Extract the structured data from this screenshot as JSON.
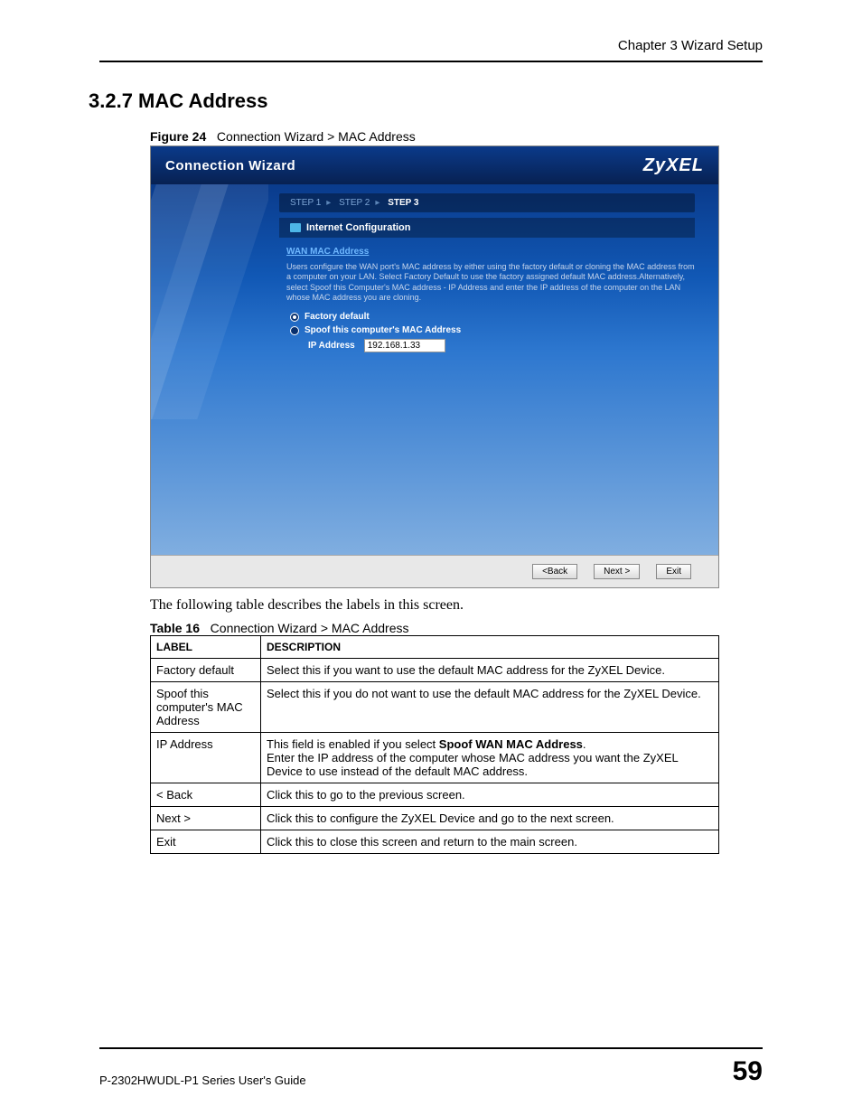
{
  "header": {
    "chapter": "Chapter 3 Wizard Setup"
  },
  "section": {
    "number_title": "3.2.7  MAC Address"
  },
  "figure": {
    "label": "Figure 24",
    "caption": "Connection Wizard > MAC Address"
  },
  "wizard": {
    "title": "Connection Wizard",
    "brand": "ZyXEL",
    "steps": {
      "s1": "STEP 1",
      "s2": "STEP 2",
      "s3": "STEP 3"
    },
    "section_bar": "Internet Configuration",
    "sub_label": "WAN MAC Address",
    "help_text": "Users configure the WAN port's MAC address by either using the factory default or cloning the MAC address from a computer on your LAN. Select Factory Default to use the factory assigned default MAC address.Alternatively, select Spoof this Computer's MAC address - IP Address and enter the IP address of the computer on the LAN whose MAC address you are cloning.",
    "radio1": "Factory default",
    "radio2": "Spoof this computer's MAC Address",
    "ip_label": "IP Address",
    "ip_value": "192.168.1.33",
    "buttons": {
      "back": "<Back",
      "next": "Next >",
      "exit": "Exit"
    }
  },
  "para": "The following table describes the labels in this screen.",
  "table": {
    "label": "Table 16",
    "caption": "Connection Wizard > MAC Address",
    "headers": {
      "c1": "LABEL",
      "c2": "DESCRIPTION"
    },
    "rows": [
      {
        "label": "Factory default",
        "desc": "Select this if you want to use the default MAC address for the ZyXEL Device."
      },
      {
        "label": "Spoof this computer's MAC Address",
        "desc": "Select this if you do not want to use the default MAC address for the ZyXEL Device."
      },
      {
        "label": "IP Address",
        "desc_line1a": "This field is enabled if you select ",
        "desc_line1b": "Spoof WAN MAC Address",
        "desc_line1c": ".",
        "desc_line2": "Enter the IP address of the computer whose MAC address you want the ZyXEL Device to use instead of the default MAC address."
      },
      {
        "label": "< Back",
        "desc": "Click this to go to the previous screen."
      },
      {
        "label": "Next >",
        "desc": "Click this to configure the ZyXEL Device and go to the next screen."
      },
      {
        "label": "Exit",
        "desc": "Click this to close this screen and return to the main screen."
      }
    ]
  },
  "footer": {
    "guide": "P-2302HWUDL-P1 Series User's Guide",
    "page": "59"
  }
}
